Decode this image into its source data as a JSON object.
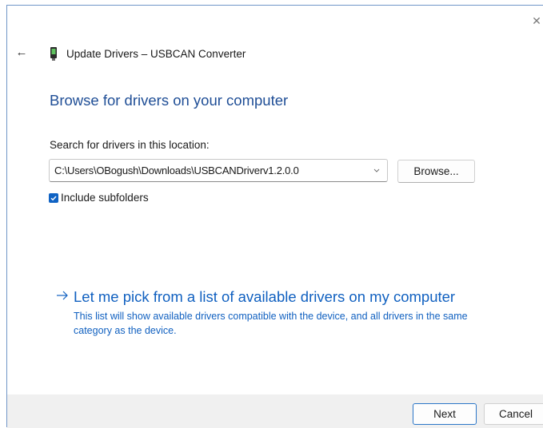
{
  "window": {
    "close_glyph": "✕",
    "back_glyph": "←",
    "device_icon": "usb-device-icon",
    "title": "Update Drivers – USBCAN Converter"
  },
  "main": {
    "page_title": "Browse for drivers on your computer",
    "search_label": "Search for drivers in this location:",
    "path_value": "C:\\Users\\OBogush\\Downloads\\USBCANDriverv1.2.0.0",
    "browse_label": "Browse...",
    "include_subfolders": {
      "label": "Include subfolders",
      "checked": true
    },
    "pick_link": {
      "title": "Let me pick from a list of available drivers on my computer",
      "description": "This list will show available drivers compatible with the device, and all drivers in the same category as the device."
    }
  },
  "footer": {
    "next_label": "Next",
    "cancel_label": "Cancel"
  },
  "colors": {
    "accent": "#1060c0",
    "title_blue": "#1f4e96",
    "checkbox": "#1063c4",
    "footer_bg": "#f0f0f0"
  }
}
